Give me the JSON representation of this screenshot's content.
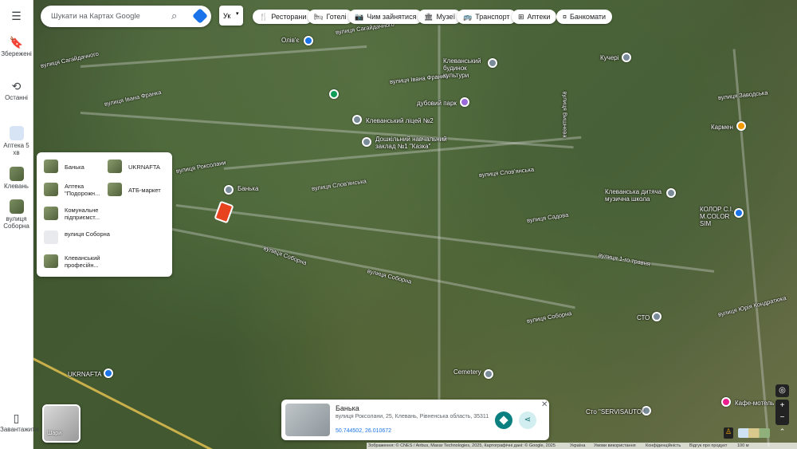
{
  "search": {
    "placeholder": "Шукати на Картах Google"
  },
  "language": {
    "label": "Ук"
  },
  "chips": [
    {
      "label": "Ресторани",
      "icon": "fork-knife-icon"
    },
    {
      "label": "Готелі",
      "icon": "bed-icon"
    },
    {
      "label": "Чим зайнятися",
      "icon": "camera-icon"
    },
    {
      "label": "Музеї",
      "icon": "museum-icon"
    },
    {
      "label": "Транспорт",
      "icon": "bus-icon"
    },
    {
      "label": "Аптеки",
      "icon": "pharmacy-icon"
    },
    {
      "label": "Банкомати",
      "icon": "atm-icon"
    }
  ],
  "rail": {
    "saved": "Збережені",
    "recent": "Останні",
    "recent_items": [
      {
        "label": "Аптека 5 хв"
      },
      {
        "label": "Клевань"
      },
      {
        "label": "вулиця Соборна"
      }
    ],
    "install": "Завантажити"
  },
  "suggestions": [
    {
      "label": "Банька"
    },
    {
      "label": "UKRNAFTA"
    },
    {
      "label": "Аптека \"Подорожн..."
    },
    {
      "label": "АТБ-маркет"
    },
    {
      "label": "Комунальне підприємст..."
    },
    {
      "label": "вулиця Соборна"
    },
    {
      "label": "Клеванський професійн..."
    }
  ],
  "place_card": {
    "title": "Банька",
    "address": "вулиця Роксолани, 25, Клевань, Рівненська область, 35311",
    "coords": "50.744502, 26.010672"
  },
  "layers": {
    "label": "Шари"
  },
  "map_labels": {
    "streets": [
      "вулиця Сагайдачного",
      "вулиця Сагайдачного",
      "вулиця Івана Франка",
      "вулиця Івана Франка",
      "вулиця Роксолани",
      "вулиця Слов'янська",
      "вулиця Слов'янська",
      "вулиця Садова",
      "вулиця Соборна",
      "вулиця Соборна",
      "вулиця Соборна",
      "вулиця 1-го травня",
      "вулиця Заводська",
      "вулиця Вишнева",
      "вулиця Юрія Кондратюка"
    ],
    "places": [
      "Олів'є",
      "Клеванський будинок культури",
      "Кучері",
      "дубовий парк",
      "Клеванський ліцей №2",
      "Дошкільний навчальний заклад №1 \"Казка\"",
      "Кармен",
      "Банька",
      "Клеванська дитяча музична школа",
      "КОЛОР С.І. M.COLOR SIM",
      "СТО",
      "UKRNAFTA",
      "Cemetery",
      "Кафе-мотель",
      "Сто \"SERVISAUTO\""
    ]
  },
  "attribution": "Зображення: © CNES / Airbus, Maxar Technologies, 2025, Картографічні дані: © Google, 2025",
  "footer_links": [
    "Україна",
    "Умови використання",
    "Конфіденційність",
    "Відгук про продукт"
  ],
  "scale": "100 м"
}
